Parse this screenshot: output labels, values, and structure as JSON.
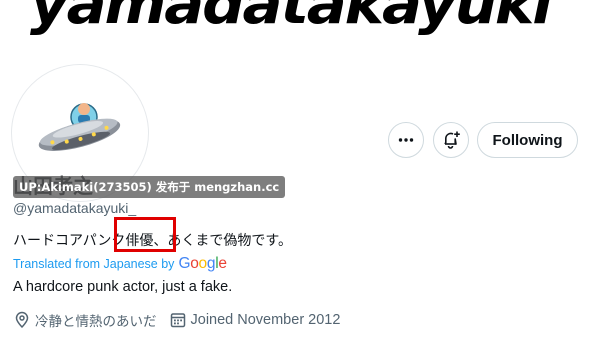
{
  "banner": {
    "text": "yamadatakayuki"
  },
  "profile": {
    "display_name": "山田孝之",
    "handle": "@yamadatakayuki_",
    "bio": "ハードコアパンク俳優、あくまで偽物です。",
    "translated_label": "Translated from Japanese by",
    "translated_provider": "Google",
    "translation": "A hardcore punk actor, just a fake.",
    "location": "冷静と情熱のあいだ",
    "joined": "Joined November 2012"
  },
  "actions": {
    "more_icon": "more-horizontal-icon",
    "notify_icon": "bell-plus-icon",
    "follow_label": "Following"
  },
  "watermark": {
    "text": "UP:Akimaki(273505) 发布于 mengzhan.cc"
  },
  "colors": {
    "link_blue": "#1d9bf0",
    "secondary_text": "#536471",
    "highlight_red": "#e00000",
    "google_blue": "#4285F4",
    "google_red": "#EA4335",
    "google_yellow": "#FBBC05",
    "google_green": "#34A853"
  }
}
